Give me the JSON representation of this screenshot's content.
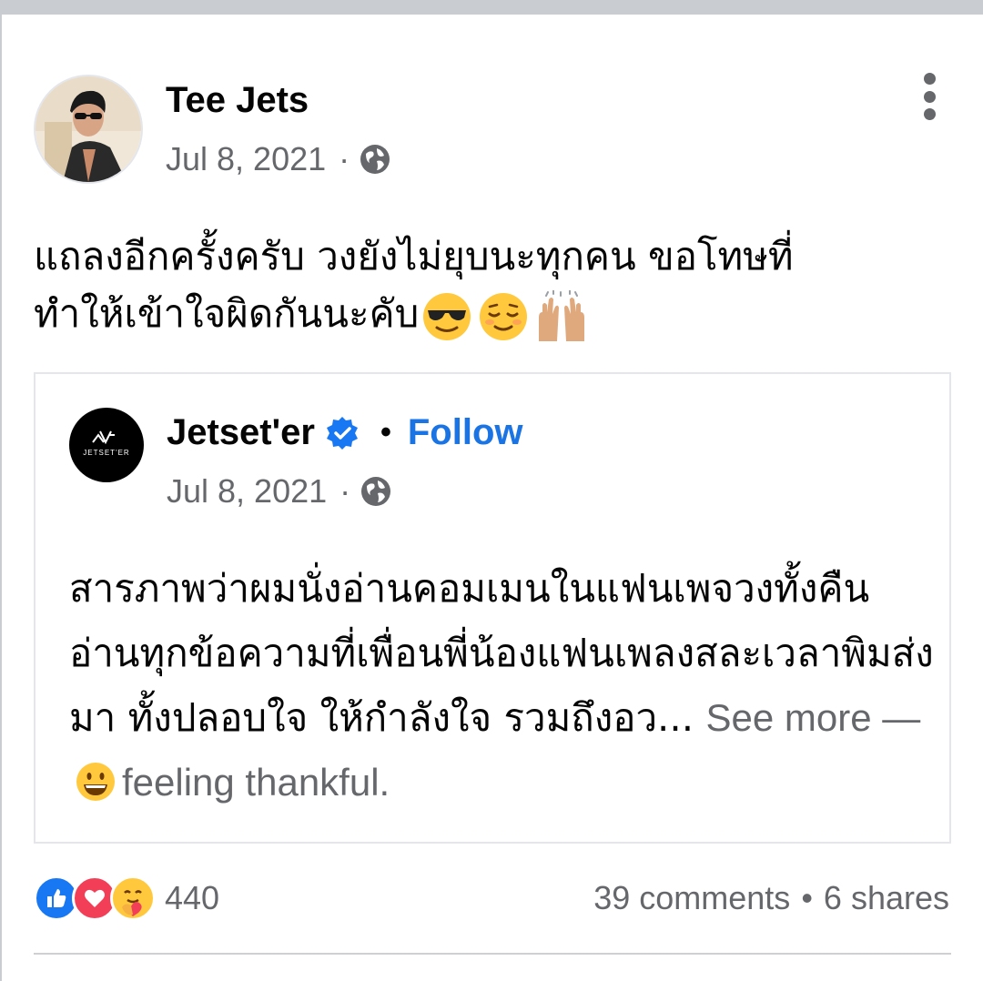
{
  "post": {
    "author": "Tee Jets",
    "date": "Jul 8, 2021",
    "separator": "·",
    "privacy_icon": "globe-icon",
    "text_line1": "แถลงอีกครั้งครับ วงยังไม่ยุบนะทุกคน ขอโทษที่",
    "text_line2": "ทำให้เข้าใจผิดกันนะคับ",
    "emojis": [
      "sunglasses-emoji",
      "relieved-emoji",
      "raised-hands-emoji"
    ]
  },
  "shared": {
    "page_name": "Jetset'er",
    "logo_text": "JETSET'ER",
    "verified_icon": "verified-badge-icon",
    "dot": "•",
    "follow_label": "Follow",
    "date": "Jul 8, 2021",
    "separator": "·",
    "text": "สารภาพว่าผมนั่งอ่านคอมเมนในแฟนเพจวงทั้งคืน อ่านทุกข้อความที่เพื่อนพี่น้องแฟนเพลงสละเวลาพิมส่งมา ทั้งปลอบใจ ให้กำลังใจ รวมถึงอว...",
    "see_more": "See more",
    "dash": " — ",
    "feeling": "feeling thankful."
  },
  "footer": {
    "reaction_count": "440",
    "reactions": [
      "like-reaction",
      "love-reaction",
      "care-reaction"
    ],
    "comments": "39 comments",
    "dot": "•",
    "shares": "6 shares"
  },
  "colors": {
    "link": "#1b74e4",
    "secondary_text": "#65676b",
    "like": "#1877f2",
    "love": "#f33e58"
  }
}
